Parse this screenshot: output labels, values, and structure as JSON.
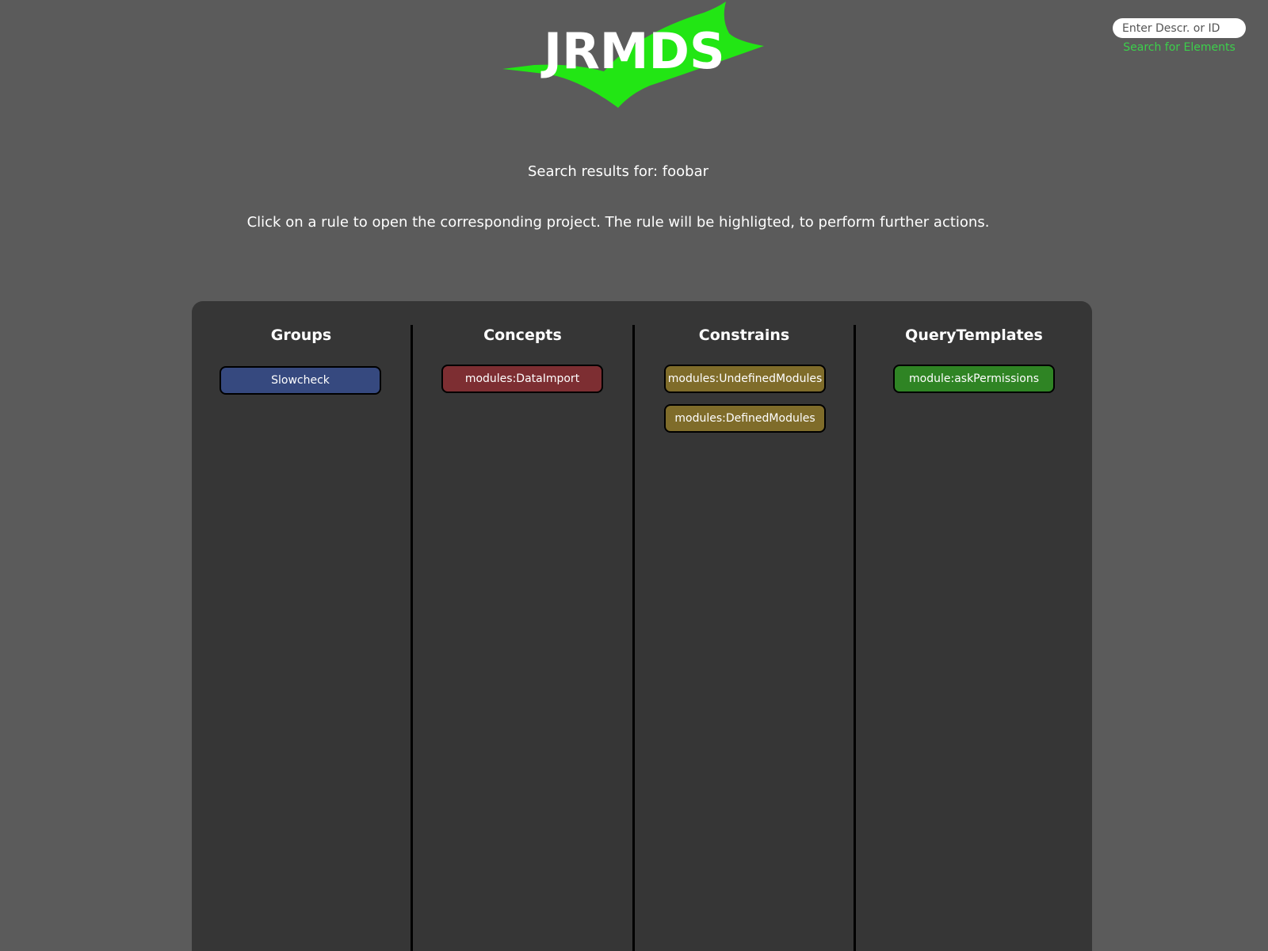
{
  "logo": {
    "text": "JRMDS",
    "check_color": "#22e614"
  },
  "search": {
    "placeholder": "Enter Descr. or ID",
    "value": "",
    "link_label": "Search for Elements"
  },
  "results": {
    "title": "Search results for: foobar",
    "instructions": "Click on a rule to open the corresponding project. The rule will be highligted, to perform further actions."
  },
  "columns": [
    {
      "title": "Groups",
      "color": "#36497f",
      "items": [
        "Slowcheck"
      ]
    },
    {
      "title": "Concepts",
      "color": "#7d2e32",
      "items": [
        "modules:DataImport"
      ]
    },
    {
      "title": "Constrains",
      "color": "#7f6c2a",
      "items": [
        "modules:UndefinedModules",
        "modules:DefinedModules"
      ]
    },
    {
      "title": "QueryTemplates",
      "color": "#2f8424",
      "items": [
        "module:askPermissions"
      ]
    }
  ]
}
